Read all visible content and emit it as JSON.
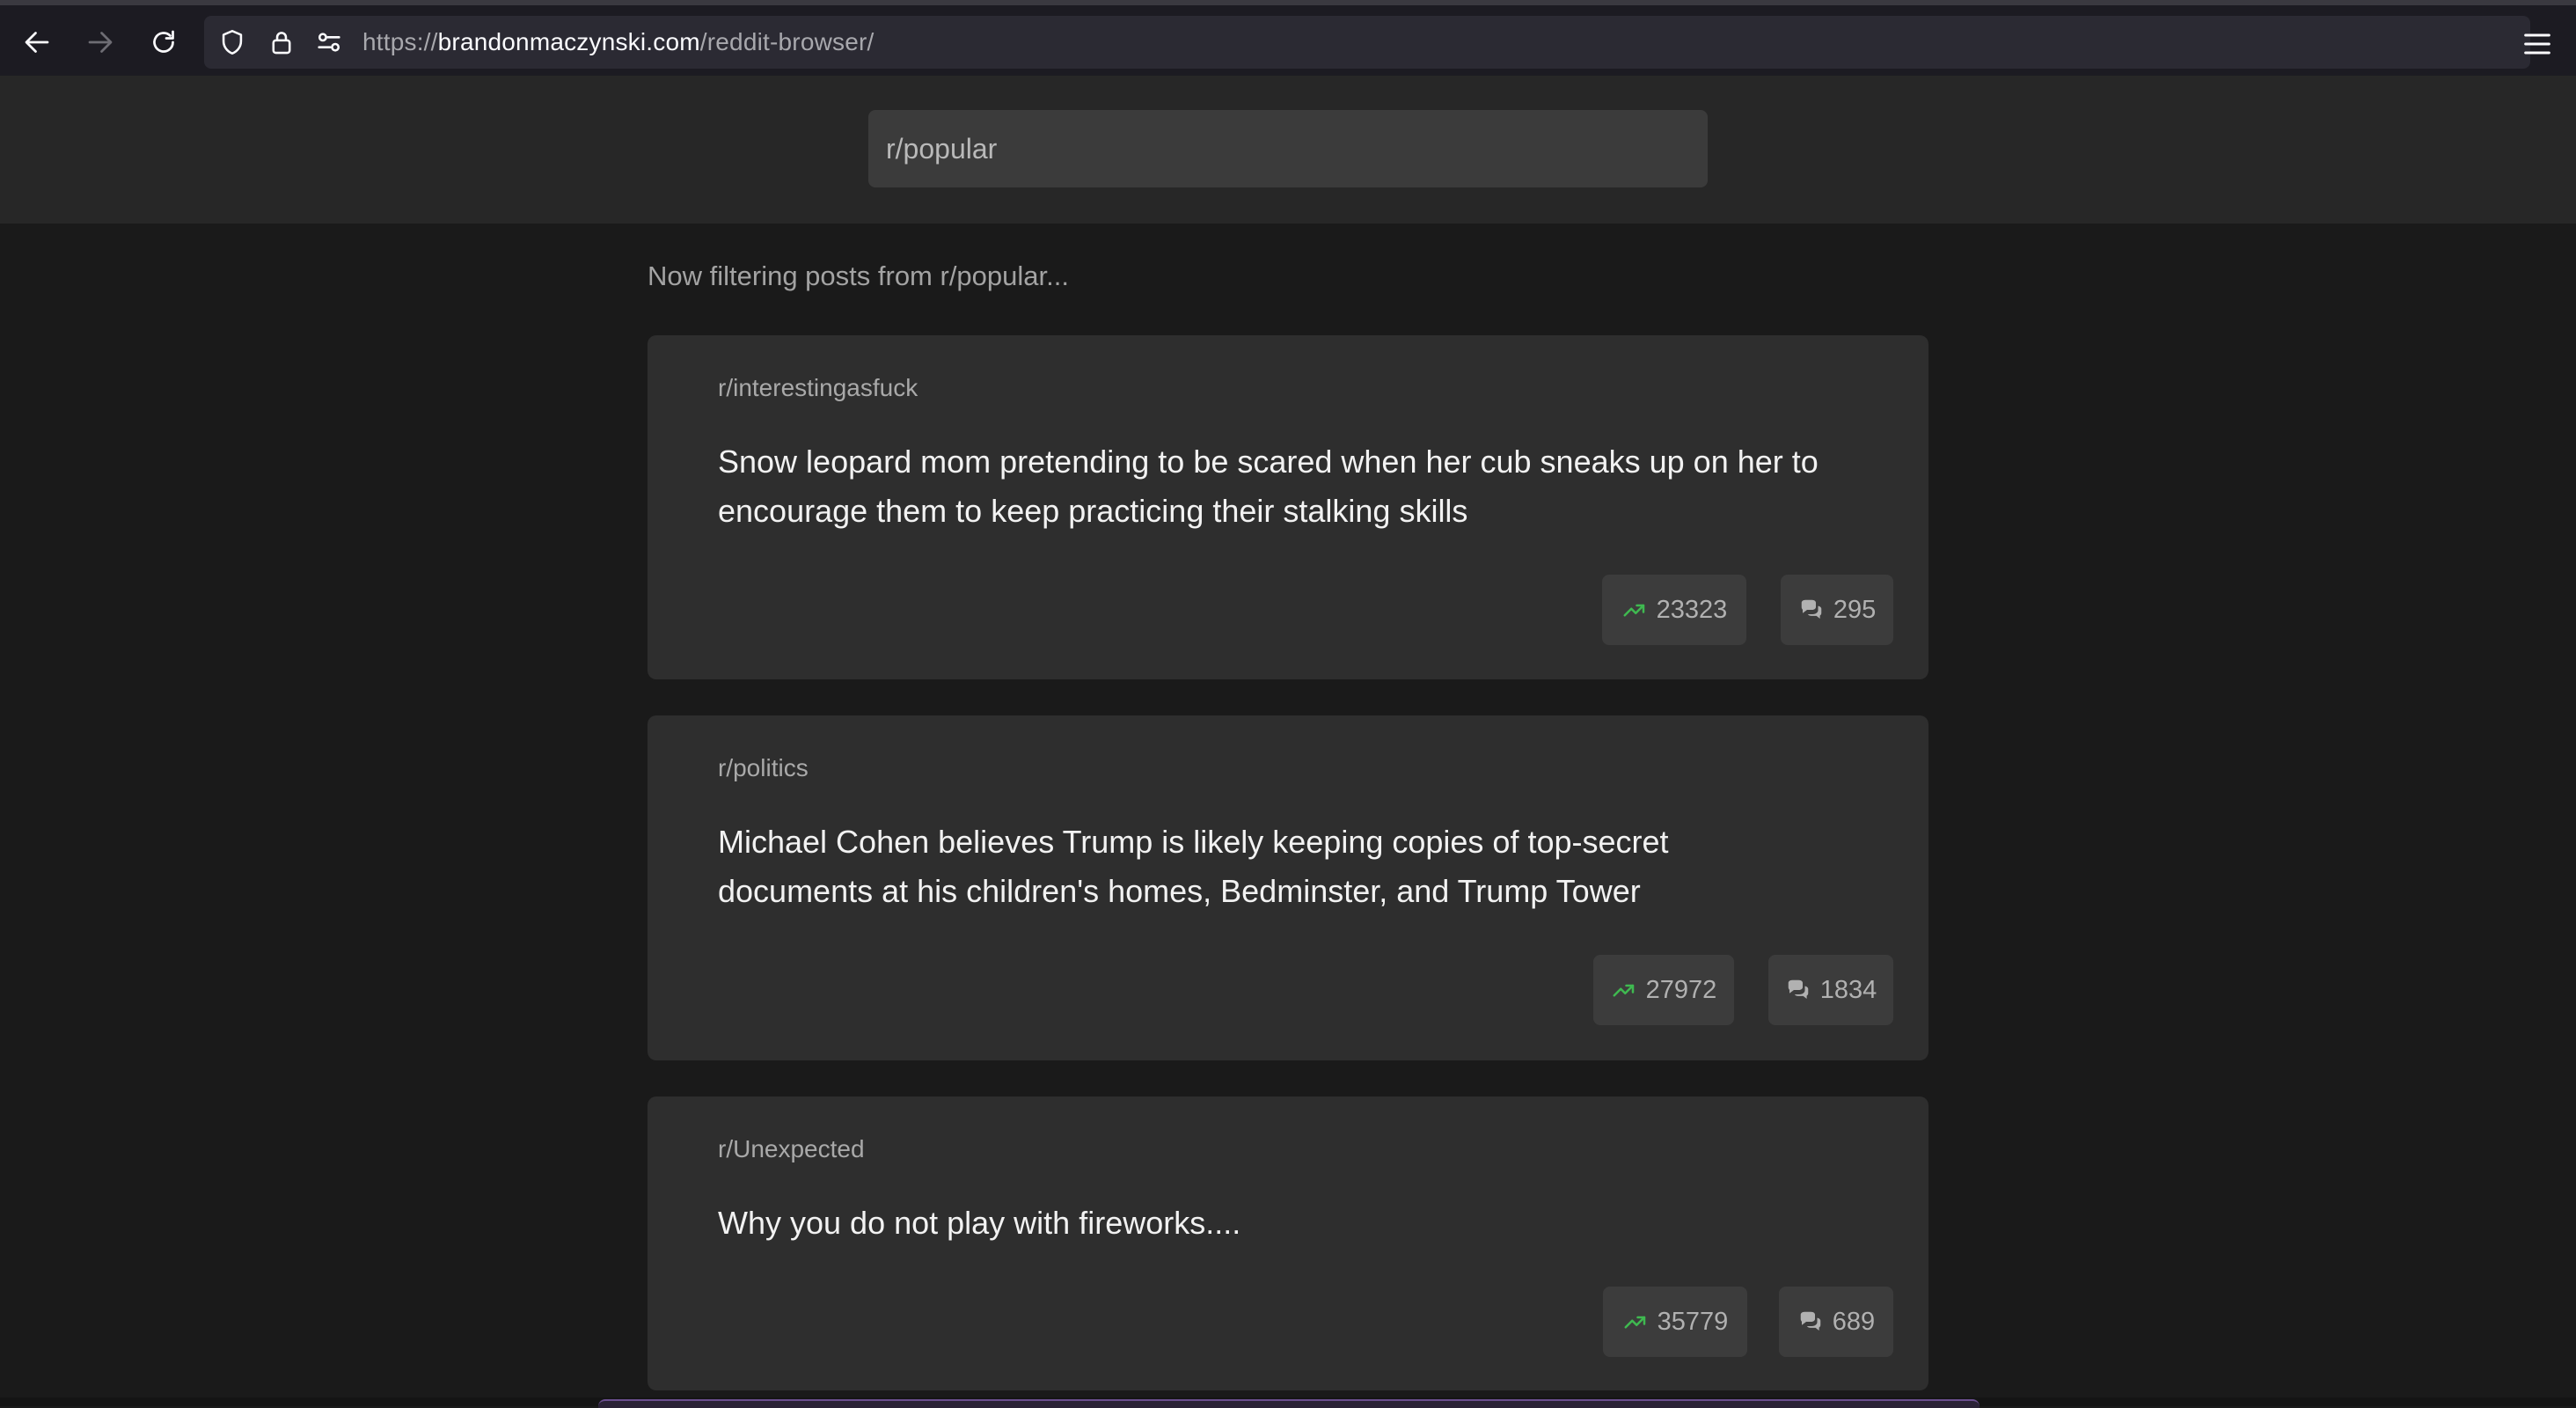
{
  "browser": {
    "url_prefix": "https://",
    "url_host": "brandonmaczynski.com",
    "url_path": "/reddit-browser/"
  },
  "search": {
    "value": "r/popular",
    "placeholder": ""
  },
  "feed": {
    "filter_note": "Now filtering posts from r/popular...",
    "posts": [
      {
        "subreddit": "r/interestingasfuck",
        "title": "Snow leopard mom pretending to be scared when her cub sneaks up on her to encourage them to keep practicing their stalking skills",
        "score": "23323",
        "comments": "295"
      },
      {
        "subreddit": "r/politics",
        "title": "Michael Cohen believes Trump is likely keeping copies of top-secret documents at his children's homes, Bedminster, and Trump Tower",
        "score": "27972",
        "comments": "1834"
      },
      {
        "subreddit": "r/Unexpected",
        "title": "Why you do not play with fireworks....",
        "score": "35779",
        "comments": "689"
      }
    ]
  },
  "colors": {
    "trend_icon": "#3fb950",
    "card_bg": "#2e2e2e",
    "page_bg": "#1a1a1a"
  }
}
